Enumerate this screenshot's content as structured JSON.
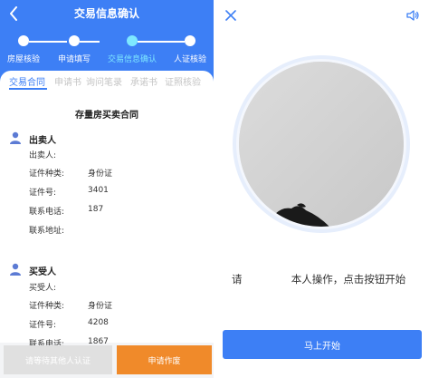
{
  "left": {
    "title": "交易信息确认",
    "steps": [
      {
        "label": "房屋核验",
        "active": false
      },
      {
        "label": "申请填写",
        "active": false
      },
      {
        "label": "交易信息确认",
        "active": true
      },
      {
        "label": "人证核验",
        "active": false
      }
    ],
    "tabs": [
      "交易合同",
      "申请书",
      "询问笔录",
      "承诺书",
      "证照核验"
    ],
    "doc_title": "存量房买卖合同",
    "seller": {
      "title": "出卖人",
      "name_label": "出卖人:",
      "id_type_label": "证件种类:",
      "id_type_value": "身份证",
      "id_no_label": "证件号:",
      "id_no_value": "3401",
      "phone_label": "联系电话:",
      "phone_value": "187",
      "address_label": "联系地址:"
    },
    "buyer": {
      "title": "买受人",
      "name_label": "买受人:",
      "id_type_label": "证件种类:",
      "id_type_value": "身份证",
      "id_no_label": "证件号:",
      "id_no_value": "4208",
      "phone_label": "联系电话:",
      "phone_value": "1867"
    },
    "btn_wait": "请等待其他人认证",
    "btn_cancel": "申请作废"
  },
  "right": {
    "prompt_a": "请",
    "prompt_b": "本人操作，点击按钮开始",
    "start_label": "马上开始"
  },
  "colors": {
    "primary": "#3d7ff5",
    "orange": "#f08a2a",
    "active_step": "#7ee8ff"
  },
  "icons": [
    "back-arrow-icon",
    "person-icon",
    "close-icon",
    "speaker-icon"
  ]
}
